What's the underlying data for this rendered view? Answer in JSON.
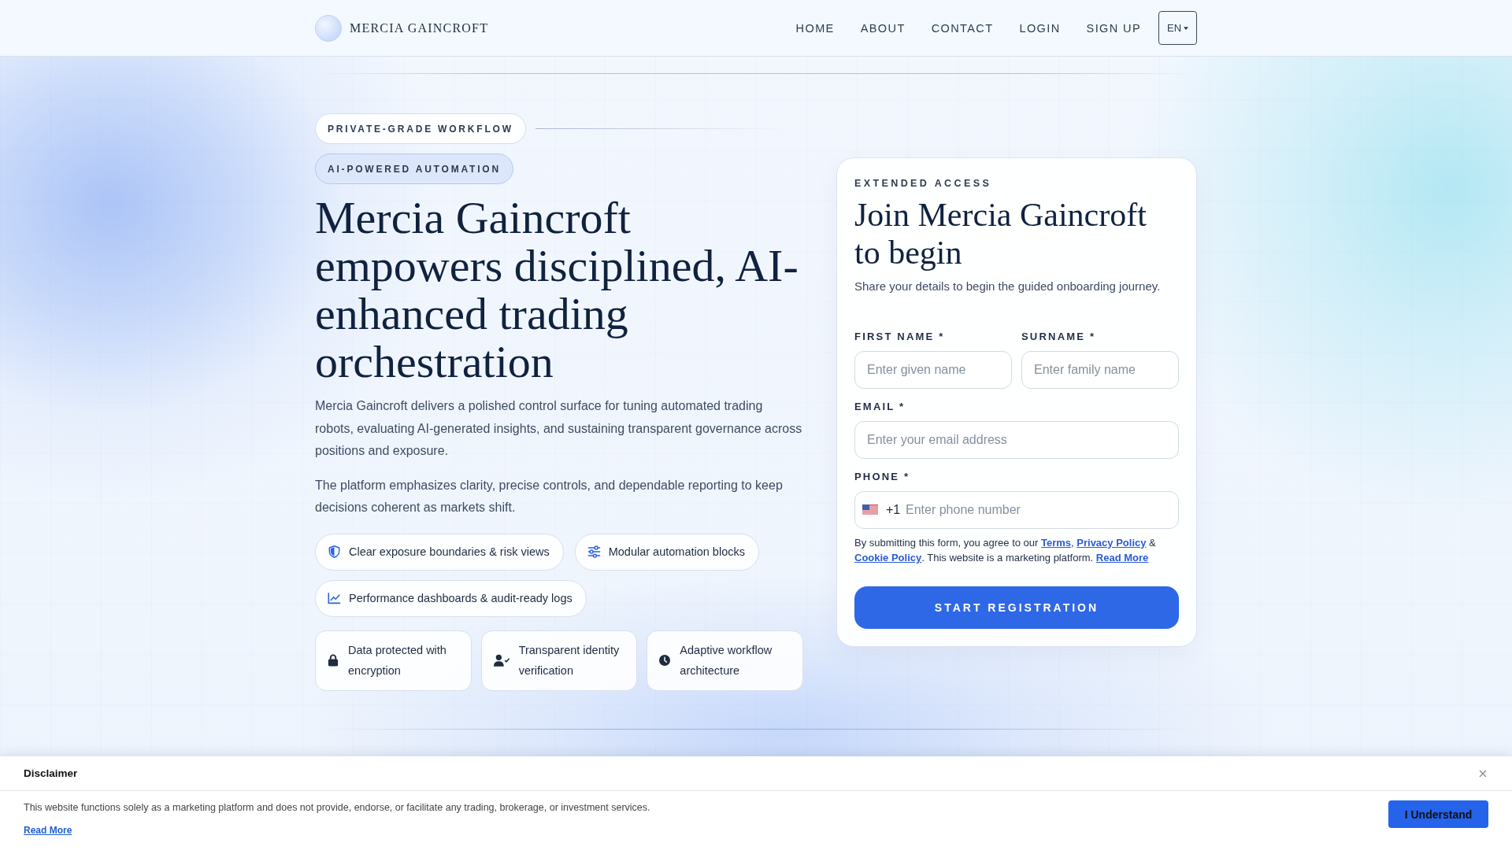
{
  "header": {
    "brand": "MERCIA GAINCROFT",
    "nav": [
      "HOME",
      "ABOUT",
      "CONTACT",
      "LOGIN",
      "SIGN UP"
    ],
    "language": "EN"
  },
  "hero": {
    "badges": [
      {
        "label": "PRIVATE-GRADE WORKFLOW",
        "kind": "outline"
      },
      {
        "label": "AI-POWERED AUTOMATION",
        "kind": "tinted"
      }
    ],
    "headline": "Mercia Gaincroft empowers disciplined, AI-enhanced trading orchestration",
    "paragraphs": [
      "Mercia Gaincroft delivers a polished control surface for tuning automated trading robots, evaluating AI-generated insights, and sustaining transparent governance across positions and exposure.",
      "The platform emphasizes clarity, precise controls, and dependable reporting to keep decisions coherent as markets shift."
    ],
    "features": [
      "Clear exposure boundaries & risk views",
      "Modular automation blocks",
      "Performance dashboards & audit-ready logs"
    ],
    "assurances": [
      "Data protected with encryption",
      "Transparent identity verification",
      "Adaptive workflow architecture"
    ]
  },
  "form": {
    "eyebrow": "EXTENDED ACCESS",
    "title": "Join Mercia Gaincroft to begin",
    "subtitle": "Share your details to begin the guided onboarding journey.",
    "fields": [
      {
        "kind": "name",
        "label": "FIRST NAME *",
        "placeholder": "Enter given name"
      },
      {
        "kind": "name",
        "label": "SURNAME *",
        "placeholder": "Enter family name"
      },
      {
        "kind": "email",
        "label": "EMAIL *",
        "placeholder": "Enter your email address"
      },
      {
        "kind": "phone",
        "label": "PHONE *",
        "dial_code": "+1",
        "placeholder": "Enter phone number"
      }
    ],
    "consent": [
      {
        "kind": "text",
        "text": "By submitting this form, you agree to our "
      },
      {
        "kind": "link",
        "text": "Terms"
      },
      {
        "kind": "text",
        "text": ", "
      },
      {
        "kind": "link",
        "text": "Privacy Policy"
      },
      {
        "kind": "text",
        "text": " & "
      },
      {
        "kind": "link",
        "text": "Cookie Policy"
      },
      {
        "kind": "text",
        "text": ". This website is a marketing platform. "
      },
      {
        "kind": "link",
        "text": "Read More"
      }
    ],
    "submit": "START REGISTRATION"
  },
  "disclaimer": {
    "title": "Disclaimer",
    "text": "This website functions solely as a marketing platform and does not provide, endorse, or facilitate any trading, brokerage, or investment services.",
    "link": "Read More",
    "button": "I Understand"
  }
}
